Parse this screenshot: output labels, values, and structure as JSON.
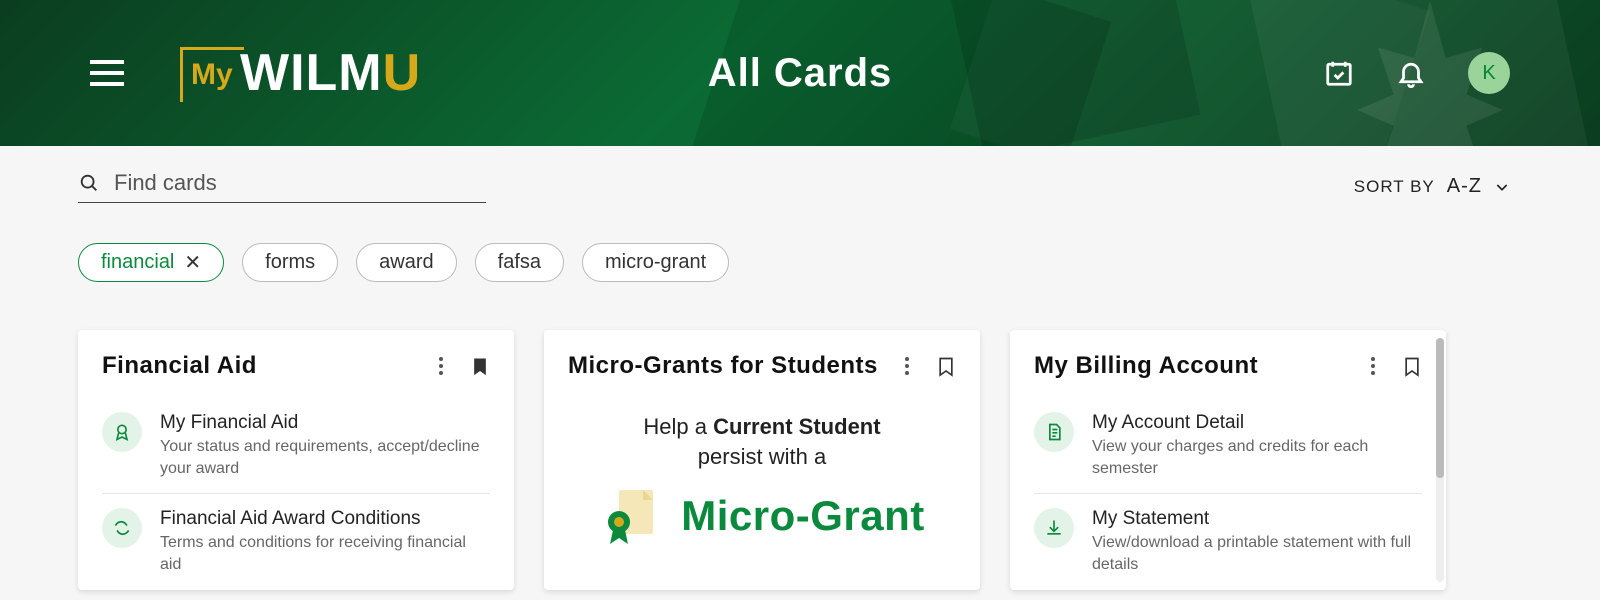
{
  "header": {
    "page_title": "All Cards",
    "avatar_letter": "K",
    "logo": {
      "my": "My",
      "wilm": "WILM",
      "u": "U"
    }
  },
  "search": {
    "placeholder": "Find cards"
  },
  "sort": {
    "label": "SORT BY",
    "value": "A-Z"
  },
  "chips": [
    {
      "label": "financial",
      "active": true
    },
    {
      "label": "forms",
      "active": false
    },
    {
      "label": "award",
      "active": false
    },
    {
      "label": "fafsa",
      "active": false
    },
    {
      "label": "micro-grant",
      "active": false
    }
  ],
  "cards": [
    {
      "title": "Financial Aid",
      "bookmarked": true,
      "items": [
        {
          "title": "My Financial Aid",
          "sub": "Your status and requirements, accept/decline your award",
          "icon": "ribbon"
        },
        {
          "title": "Financial Aid Award Conditions",
          "sub": "Terms and conditions for receiving financial aid",
          "icon": "swap"
        }
      ]
    },
    {
      "title": "Micro-Grants for Students",
      "bookmarked": false,
      "micro": {
        "line_pre": "Help a ",
        "line_bold": "Current Student",
        "line2": "persist with a",
        "big": "Micro-Grant"
      }
    },
    {
      "title": "My Billing Account",
      "bookmarked": false,
      "items": [
        {
          "title": "My Account Detail",
          "sub": "View your charges and credits for each semester",
          "icon": "doc"
        },
        {
          "title": "My Statement",
          "sub": "View/download a printable statement with full details",
          "icon": "download"
        }
      ]
    }
  ]
}
